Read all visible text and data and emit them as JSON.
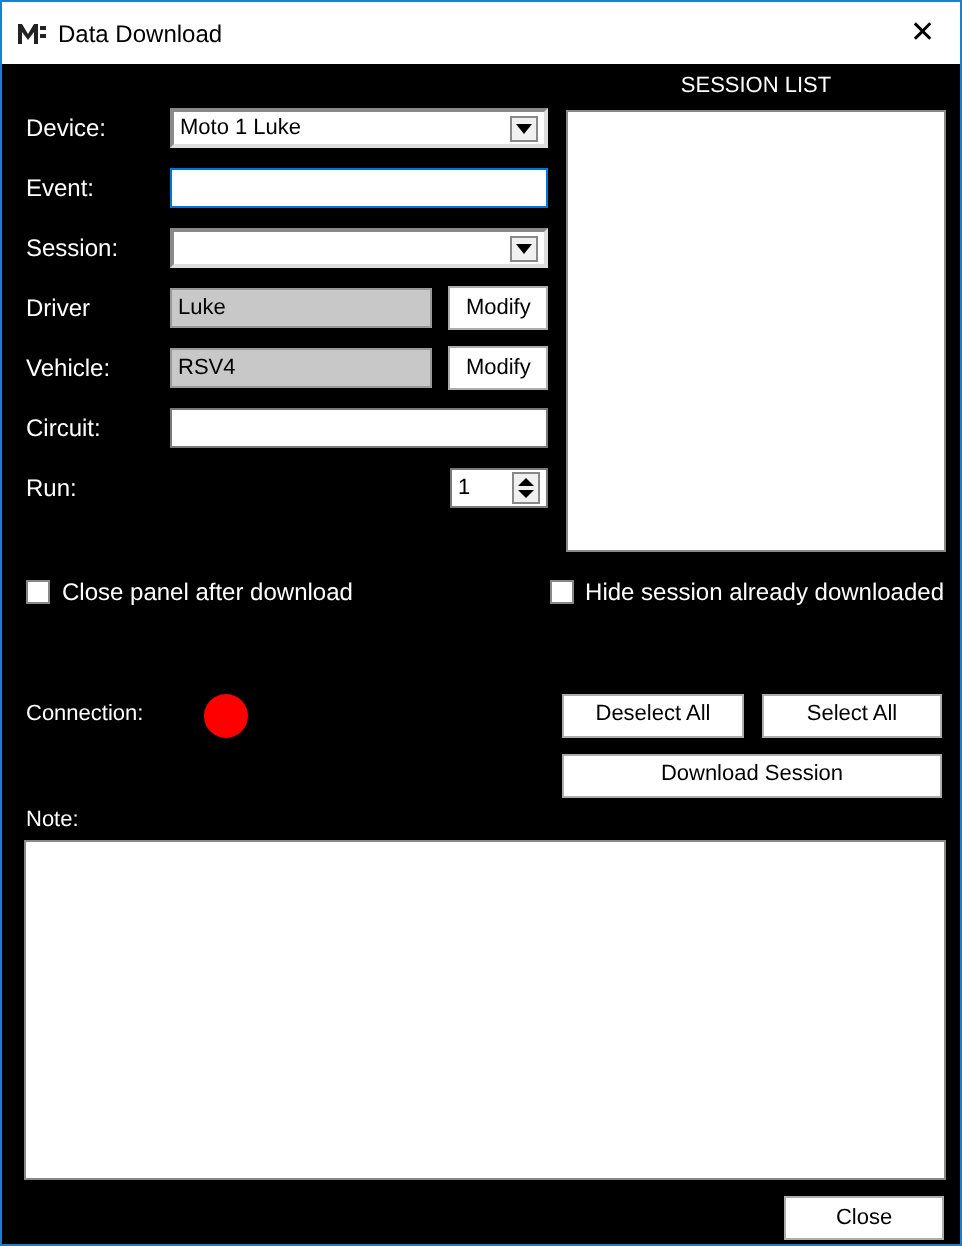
{
  "window": {
    "title": "Data Download",
    "close": "✕"
  },
  "fields": [
    {
      "kind": "select",
      "label": "Device:",
      "value": "Moto 1 Luke",
      "focused": false
    },
    {
      "kind": "text",
      "label": "Event:",
      "focused": true
    },
    {
      "kind": "select",
      "label": "Session:",
      "focused": false
    },
    {
      "kind": "readonly",
      "label": "Driver",
      "value": "Luke",
      "button": "Modify",
      "focused": false
    },
    {
      "kind": "readonly",
      "label": "Vehicle:",
      "value": "RSV4",
      "button": "Modify",
      "focused": false
    },
    {
      "kind": "text",
      "label": "Circuit:",
      "focused": false
    },
    {
      "kind": "spin",
      "label": "Run:",
      "value": "1",
      "focused": false
    }
  ],
  "session_list": {
    "title": "SESSION LIST"
  },
  "checkboxes": [
    {
      "label": "Close panel after download",
      "checked": false
    },
    {
      "label": "Hide session already downloaded",
      "checked": false
    }
  ],
  "connection": {
    "label": "Connection:",
    "color": "#ff0000"
  },
  "buttons": {
    "deselect": "Deselect All",
    "select": "Select All",
    "download": "Download Session"
  },
  "note": {
    "label": "Note:"
  },
  "close_button": "Close"
}
